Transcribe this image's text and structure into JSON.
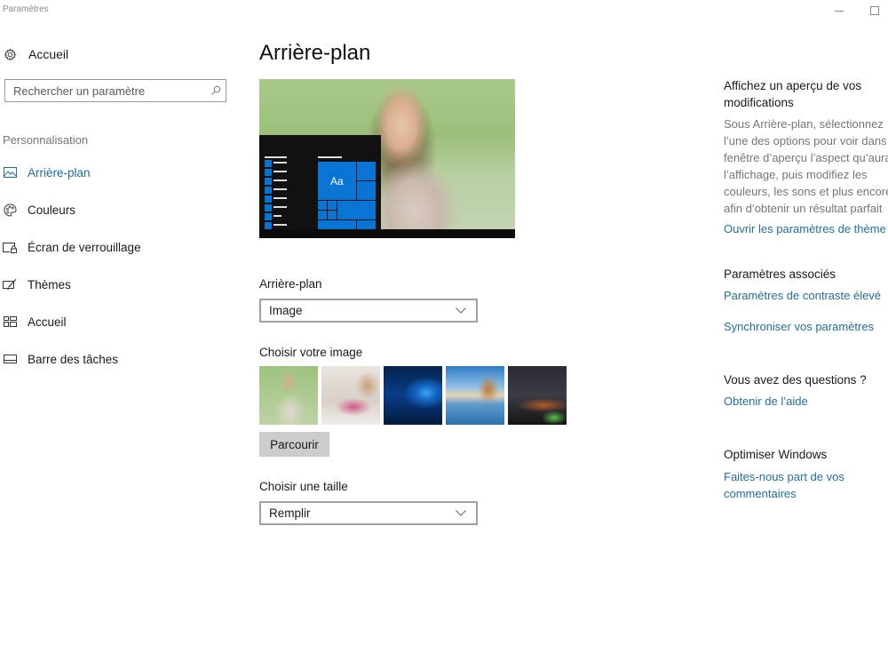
{
  "window": {
    "title": "Paramètres",
    "controls": {
      "minimize": "minimize",
      "maximize": "maximize"
    }
  },
  "sidebar": {
    "home_label": "Accueil",
    "search_placeholder": "Rechercher un paramètre",
    "section_label": "Personnalisation",
    "items": [
      {
        "label": "Arrière-plan",
        "icon": "image-icon",
        "active": true
      },
      {
        "label": "Couleurs",
        "icon": "palette-icon",
        "active": false
      },
      {
        "label": "Écran de verrouillage",
        "icon": "lock-screen-icon",
        "active": false
      },
      {
        "label": "Thèmes",
        "icon": "themes-icon",
        "active": false
      },
      {
        "label": "Accueil",
        "icon": "start-icon",
        "active": false
      },
      {
        "label": "Barre des tâches",
        "icon": "taskbar-icon",
        "active": false
      }
    ]
  },
  "main": {
    "title": "Arrière-plan",
    "preview": {
      "tile_text": "Aa"
    },
    "background_label": "Arrière-plan",
    "background_value": "Image",
    "choose_image_label": "Choisir votre image",
    "thumbnails": [
      {
        "name": "woman-by-lake"
      },
      {
        "name": "woman-on-bed"
      },
      {
        "name": "windows-10-hero"
      },
      {
        "name": "beach-rocks"
      },
      {
        "name": "night-sky-tent"
      }
    ],
    "browse_label": "Parcourir",
    "fit_label": "Choisir une taille",
    "fit_value": "Remplir"
  },
  "right": {
    "preview_heading_line1": "Affichez un aperçu de vos",
    "preview_heading_line2": "modifications",
    "preview_body": [
      "Sous Arrière-plan, sélectionnez",
      "l’une des options pour voir dans",
      "fenêtre d’aperçu l’aspect qu’aura",
      "l’affichage, puis modifiez les",
      "couleurs, les sons et plus encore",
      "afin d’obtenir un résultat parfait"
    ],
    "theme_link": "Ouvrir les paramètres de thème",
    "related_heading": "Paramètres associés",
    "contrast_link": "Paramètres de contraste élevé",
    "sync_link": "Synchroniser vos paramètres",
    "questions_heading": "Vous avez des questions ?",
    "help_link": "Obtenir de l’aide",
    "optimize_heading": "Optimiser Windows",
    "feedback_link_line1": "Faites-nous part de vos",
    "feedback_link_line2": "commentaires"
  },
  "colors": {
    "accent": "#1f6ea8",
    "tile": "#0a74d4"
  }
}
